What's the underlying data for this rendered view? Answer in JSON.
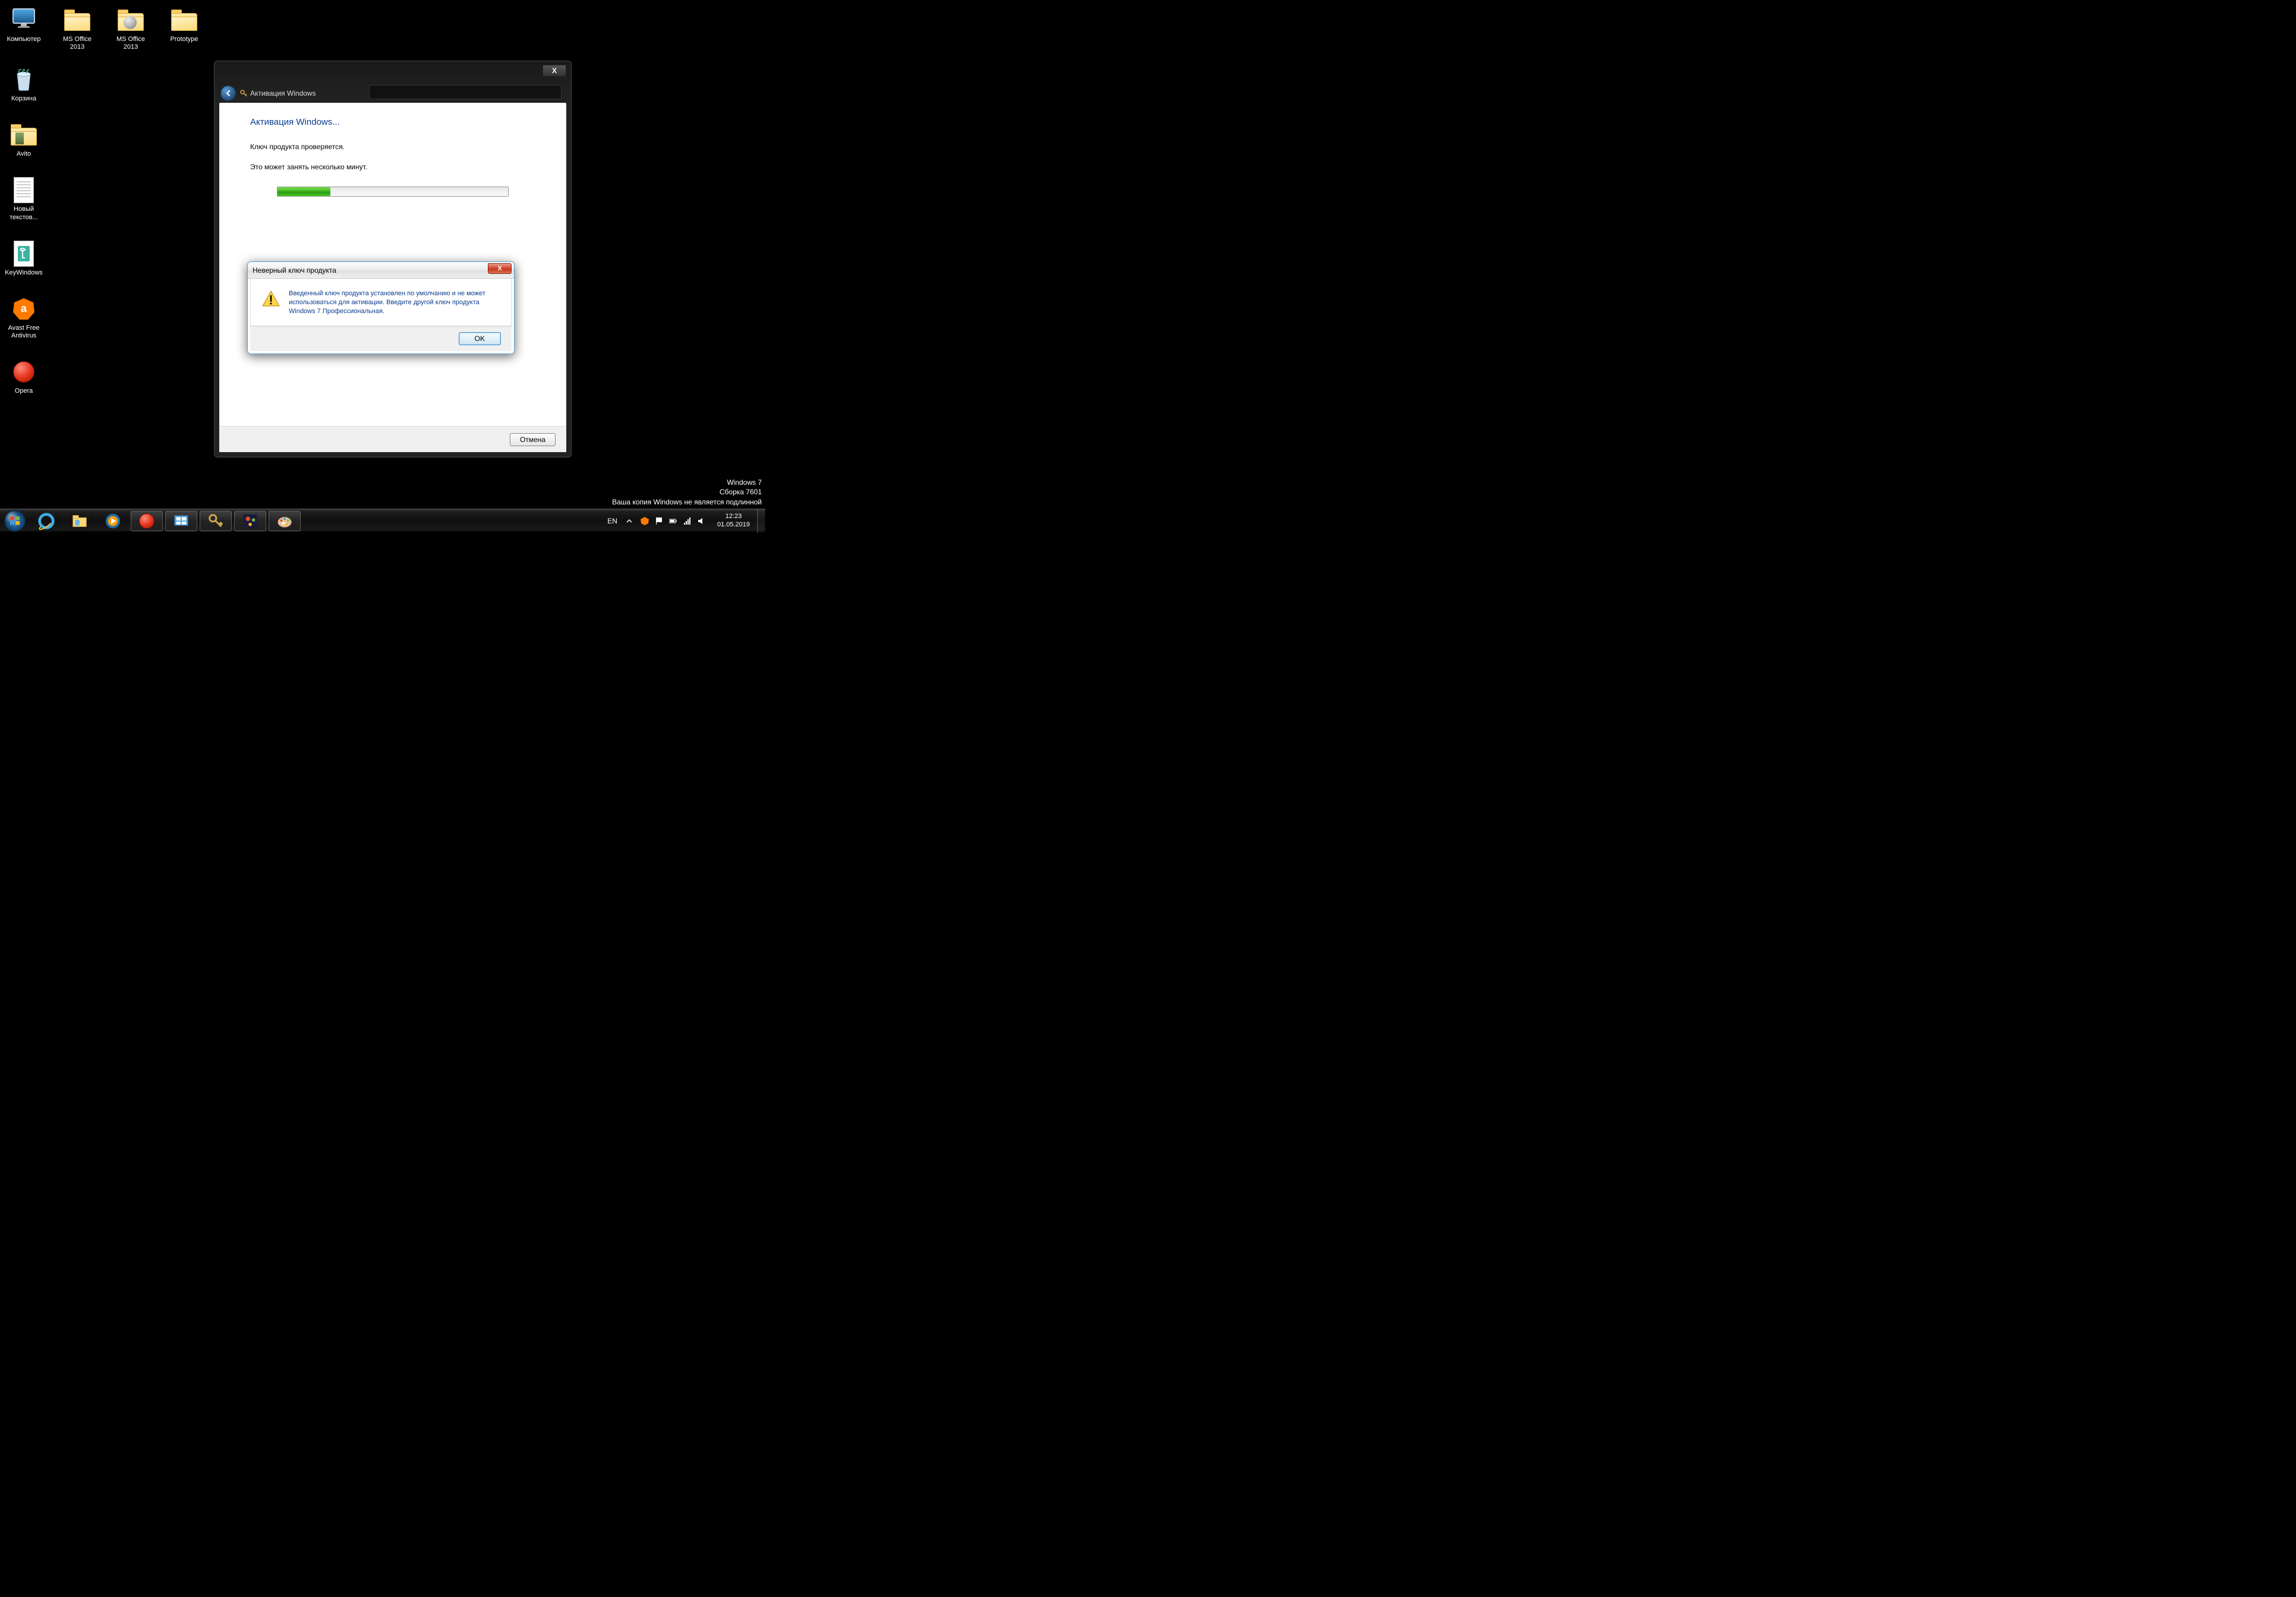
{
  "desktop": {
    "row1": [
      {
        "label": "Компьютер",
        "type": "computer"
      },
      {
        "label": "MS Office 2013",
        "type": "folder"
      },
      {
        "label": "MS Office 2013",
        "type": "folder-disc"
      },
      {
        "label": "Prototype",
        "type": "folder"
      }
    ],
    "col": [
      {
        "label": "Корзина",
        "type": "bin"
      },
      {
        "label": "Avito",
        "type": "folder"
      },
      {
        "label": "Новый текстов...",
        "type": "doc"
      },
      {
        "label": "KeyWindows",
        "type": "keydoc"
      },
      {
        "label": "Avast Free Antivirus",
        "type": "avast"
      },
      {
        "label": "Opera",
        "type": "opera"
      }
    ]
  },
  "watermark": {
    "line1": "Windows 7",
    "line2": "Сборка 7601",
    "line3": "Ваша копия Windows не является подлинной"
  },
  "activation": {
    "nav_title": "Активация Windows",
    "heading": "Активация Windows...",
    "line1": "Ключ продукта проверяется.",
    "line2": "Это может занять несколько минут.",
    "cancel": "Отмена",
    "progress_percent": 23
  },
  "msgbox": {
    "title": "Неверный ключ продукта",
    "text": "Введенный ключ продукта установлен по умолчанию и не может использоваться для активации. Введите другой ключ продукта Windows 7 Профессиональная.",
    "ok": "OK"
  },
  "taskbar": {
    "lang": "EN",
    "time": "12:23",
    "date": "01.05.2019"
  }
}
